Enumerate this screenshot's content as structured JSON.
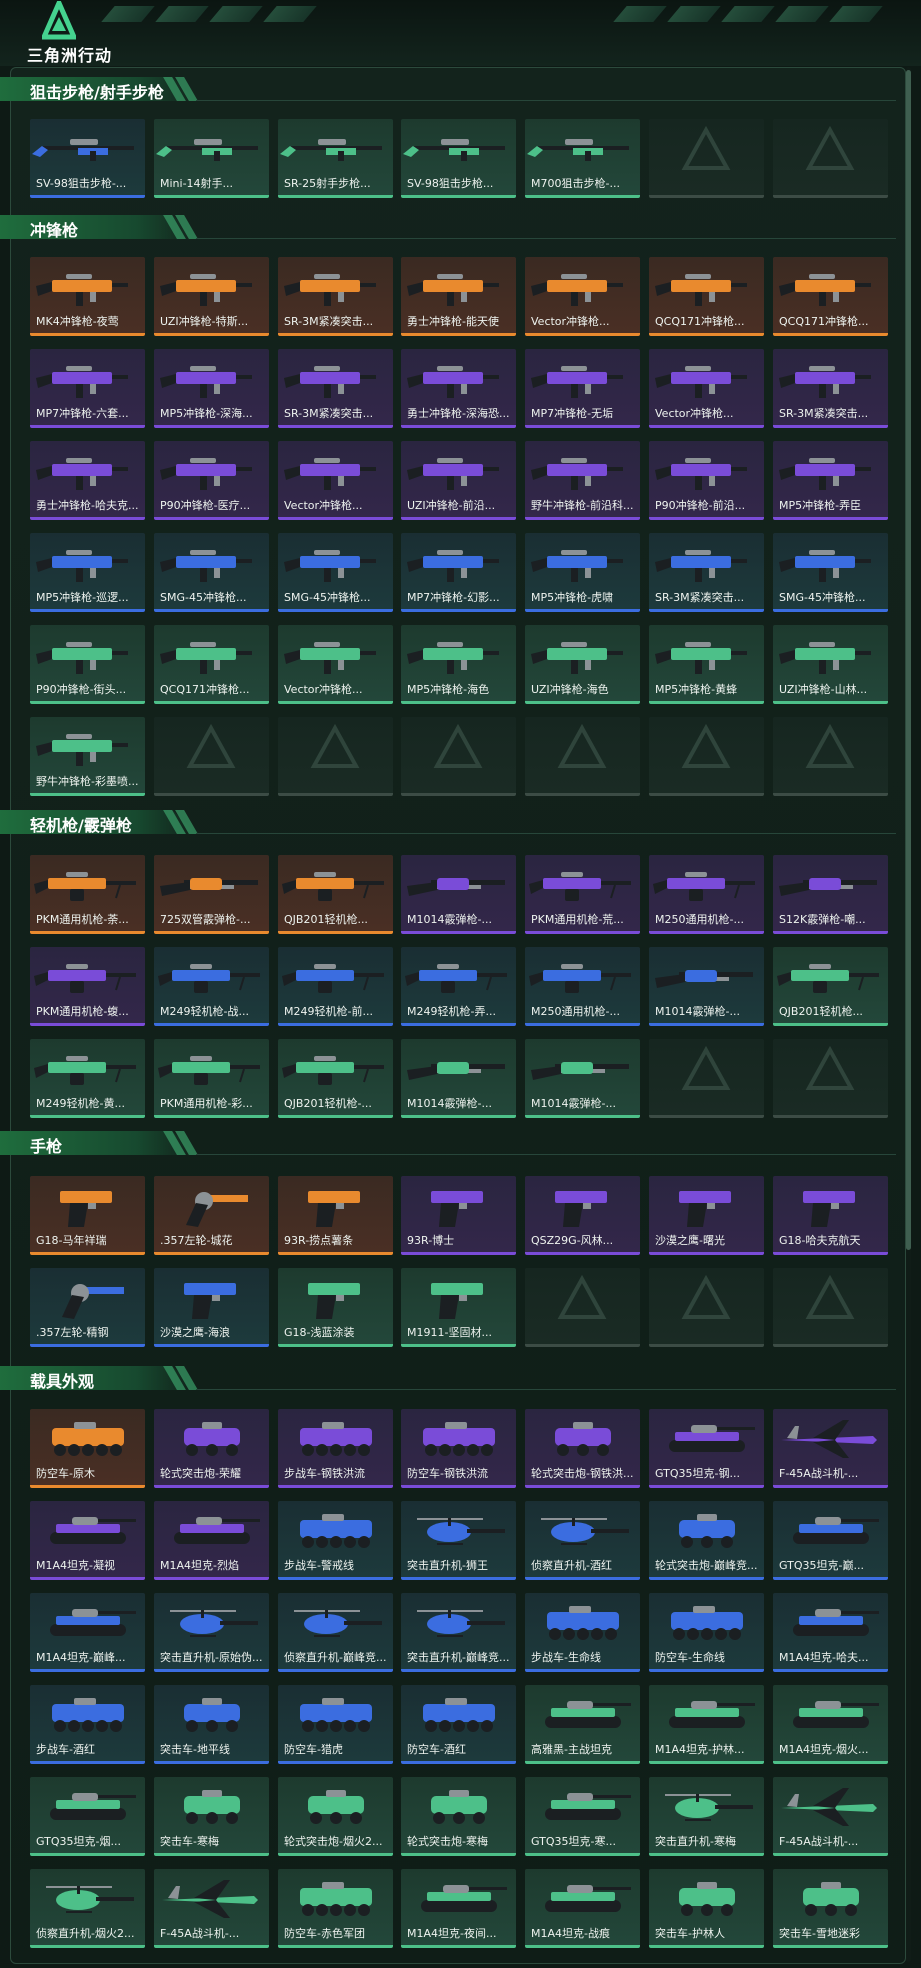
{
  "header": {
    "title": "三角洲行动"
  },
  "colors": {
    "green": "#4dc089",
    "blue": "#3b6de0",
    "purple": "#7a4cd8",
    "orange": "#e98a2e"
  },
  "sections": [
    {
      "title": "狙击步枪/射手步枪",
      "items": [
        {
          "label": "SV-98狙击步枪-...",
          "rarity": "blue",
          "icon": "rifle-icon"
        },
        {
          "label": "Mini-14射手...",
          "rarity": "green",
          "icon": "rifle-icon"
        },
        {
          "label": "SR-25射手步枪...",
          "rarity": "green",
          "icon": "rifle-icon"
        },
        {
          "label": "SV-98狙击步枪...",
          "rarity": "green",
          "icon": "rifle-icon"
        },
        {
          "label": "M700狙击步枪-...",
          "rarity": "green",
          "icon": "rifle-icon"
        },
        {
          "label": "",
          "rarity": "empty",
          "icon": "empty-slot-icon"
        },
        {
          "label": "",
          "rarity": "empty",
          "icon": "empty-slot-icon"
        }
      ]
    },
    {
      "title": "冲锋枪",
      "items": [
        {
          "label": "MK4冲锋枪-夜莺",
          "rarity": "orange",
          "icon": "smg-icon"
        },
        {
          "label": "UZI冲锋枪-特斯...",
          "rarity": "orange",
          "icon": "smg-icon"
        },
        {
          "label": "SR-3M紧凑突击...",
          "rarity": "orange",
          "icon": "smg-icon"
        },
        {
          "label": "勇士冲锋枪-能天使",
          "rarity": "orange",
          "icon": "smg-icon"
        },
        {
          "label": "Vector冲锋枪...",
          "rarity": "orange",
          "icon": "smg-icon"
        },
        {
          "label": "QCQ171冲锋枪...",
          "rarity": "orange",
          "icon": "smg-icon"
        },
        {
          "label": "QCQ171冲锋枪...",
          "rarity": "orange",
          "icon": "smg-icon"
        },
        {
          "label": "MP7冲锋枪-六套...",
          "rarity": "purple",
          "icon": "smg-icon"
        },
        {
          "label": "MP5冲锋枪-深海...",
          "rarity": "purple",
          "icon": "smg-icon"
        },
        {
          "label": "SR-3M紧凑突击...",
          "rarity": "purple",
          "icon": "smg-icon"
        },
        {
          "label": "勇士冲锋枪-深海恐...",
          "rarity": "purple",
          "icon": "smg-icon"
        },
        {
          "label": "MP7冲锋枪-无垢",
          "rarity": "purple",
          "icon": "smg-icon"
        },
        {
          "label": "Vector冲锋枪...",
          "rarity": "purple",
          "icon": "smg-icon"
        },
        {
          "label": "SR-3M紧凑突击...",
          "rarity": "purple",
          "icon": "smg-icon"
        },
        {
          "label": "勇士冲锋枪-哈夫克...",
          "rarity": "purple",
          "icon": "smg-icon"
        },
        {
          "label": "P90冲锋枪-医疗...",
          "rarity": "purple",
          "icon": "smg-icon"
        },
        {
          "label": "Vector冲锋枪...",
          "rarity": "purple",
          "icon": "smg-icon"
        },
        {
          "label": "UZI冲锋枪-前沿...",
          "rarity": "purple",
          "icon": "smg-icon"
        },
        {
          "label": "野牛冲锋枪-前沿科...",
          "rarity": "purple",
          "icon": "smg-icon"
        },
        {
          "label": "P90冲锋枪-前沿...",
          "rarity": "purple",
          "icon": "smg-icon"
        },
        {
          "label": "MP5冲锋枪-弄臣",
          "rarity": "purple",
          "icon": "smg-icon"
        },
        {
          "label": "MP5冲锋枪-巡逻...",
          "rarity": "blue",
          "icon": "smg-icon"
        },
        {
          "label": "SMG-45冲锋枪...",
          "rarity": "blue",
          "icon": "smg-icon"
        },
        {
          "label": "SMG-45冲锋枪...",
          "rarity": "blue",
          "icon": "smg-icon"
        },
        {
          "label": "MP7冲锋枪-幻影...",
          "rarity": "blue",
          "icon": "smg-icon"
        },
        {
          "label": "MP5冲锋枪-虎啸",
          "rarity": "blue",
          "icon": "smg-icon"
        },
        {
          "label": "SR-3M紧凑突击...",
          "rarity": "blue",
          "icon": "smg-icon"
        },
        {
          "label": "SMG-45冲锋枪...",
          "rarity": "blue",
          "icon": "smg-icon"
        },
        {
          "label": "P90冲锋枪-街头...",
          "rarity": "green",
          "icon": "smg-icon"
        },
        {
          "label": "QCQ171冲锋枪...",
          "rarity": "green",
          "icon": "smg-icon"
        },
        {
          "label": "Vector冲锋枪...",
          "rarity": "green",
          "icon": "smg-icon"
        },
        {
          "label": "MP5冲锋枪-海色",
          "rarity": "green",
          "icon": "smg-icon"
        },
        {
          "label": "UZI冲锋枪-海色",
          "rarity": "green",
          "icon": "smg-icon"
        },
        {
          "label": "MP5冲锋枪-黄蜂",
          "rarity": "green",
          "icon": "smg-icon"
        },
        {
          "label": "UZI冲锋枪-山林...",
          "rarity": "green",
          "icon": "smg-icon"
        },
        {
          "label": "野牛冲锋枪-彩墨喷...",
          "rarity": "green",
          "icon": "smg-icon"
        },
        {
          "label": "",
          "rarity": "empty",
          "icon": "empty-slot-icon"
        },
        {
          "label": "",
          "rarity": "empty",
          "icon": "empty-slot-icon"
        },
        {
          "label": "",
          "rarity": "empty",
          "icon": "empty-slot-icon"
        },
        {
          "label": "",
          "rarity": "empty",
          "icon": "empty-slot-icon"
        },
        {
          "label": "",
          "rarity": "empty",
          "icon": "empty-slot-icon"
        },
        {
          "label": "",
          "rarity": "empty",
          "icon": "empty-slot-icon"
        }
      ]
    },
    {
      "title": "轻机枪/霰弹枪",
      "items": [
        {
          "label": "PKM通用机枪-荼...",
          "rarity": "orange",
          "icon": "machine-gun-icon"
        },
        {
          "label": "725双管霰弹枪-...",
          "rarity": "orange",
          "icon": "shotgun-icon"
        },
        {
          "label": "QJB201轻机枪...",
          "rarity": "orange",
          "icon": "machine-gun-icon"
        },
        {
          "label": "M1014霰弹枪-...",
          "rarity": "purple",
          "icon": "shotgun-icon"
        },
        {
          "label": "PKM通用机枪-荒...",
          "rarity": "purple",
          "icon": "machine-gun-icon"
        },
        {
          "label": "M250通用机枪-...",
          "rarity": "purple",
          "icon": "machine-gun-icon"
        },
        {
          "label": "S12K霰弹枪-嘲...",
          "rarity": "purple",
          "icon": "shotgun-icon"
        },
        {
          "label": "PKM通用机枪-蝮...",
          "rarity": "purple",
          "icon": "machine-gun-icon"
        },
        {
          "label": "M249轻机枪-战...",
          "rarity": "blue",
          "icon": "machine-gun-icon"
        },
        {
          "label": "M249轻机枪-前...",
          "rarity": "blue",
          "icon": "machine-gun-icon"
        },
        {
          "label": "M249轻机枪-弄...",
          "rarity": "blue",
          "icon": "machine-gun-icon"
        },
        {
          "label": "M250通用机枪-...",
          "rarity": "blue",
          "icon": "machine-gun-icon"
        },
        {
          "label": "M1014霰弹枪-...",
          "rarity": "blue",
          "icon": "shotgun-icon"
        },
        {
          "label": "QJB201轻机枪...",
          "rarity": "green",
          "icon": "machine-gun-icon"
        },
        {
          "label": "M249轻机枪-黄...",
          "rarity": "green",
          "icon": "machine-gun-icon"
        },
        {
          "label": "PKM通用机枪-彩...",
          "rarity": "green",
          "icon": "machine-gun-icon"
        },
        {
          "label": "QJB201轻机枪-...",
          "rarity": "green",
          "icon": "machine-gun-icon"
        },
        {
          "label": "M1014霰弹枪-...",
          "rarity": "green",
          "icon": "shotgun-icon"
        },
        {
          "label": "M1014霰弹枪-...",
          "rarity": "green",
          "icon": "shotgun-icon"
        },
        {
          "label": "",
          "rarity": "empty",
          "icon": "empty-slot-icon"
        },
        {
          "label": "",
          "rarity": "empty",
          "icon": "empty-slot-icon"
        }
      ]
    },
    {
      "title": "手枪",
      "items": [
        {
          "label": "G18-马年祥瑞",
          "rarity": "orange",
          "icon": "pistol-icon"
        },
        {
          "label": ".357左轮-城花",
          "rarity": "orange",
          "icon": "revolver-icon"
        },
        {
          "label": "93R-捞点薯条",
          "rarity": "orange",
          "icon": "pistol-icon"
        },
        {
          "label": "93R-博士",
          "rarity": "purple",
          "icon": "pistol-icon"
        },
        {
          "label": "QSZ29G-风林...",
          "rarity": "purple",
          "icon": "pistol-icon"
        },
        {
          "label": "沙漠之鹰-曙光",
          "rarity": "purple",
          "icon": "pistol-icon"
        },
        {
          "label": "G18-哈夫克航天",
          "rarity": "purple",
          "icon": "pistol-icon"
        },
        {
          "label": ".357左轮-精钢",
          "rarity": "blue",
          "icon": "revolver-icon"
        },
        {
          "label": "沙漠之鹰-海浪",
          "rarity": "blue",
          "icon": "pistol-icon"
        },
        {
          "label": "G18-浅蓝涂装",
          "rarity": "green",
          "icon": "pistol-icon"
        },
        {
          "label": "M1911-坚固材...",
          "rarity": "green",
          "icon": "pistol-icon"
        },
        {
          "label": "",
          "rarity": "empty",
          "icon": "empty-slot-icon"
        },
        {
          "label": "",
          "rarity": "empty",
          "icon": "empty-slot-icon"
        },
        {
          "label": "",
          "rarity": "empty",
          "icon": "empty-slot-icon"
        }
      ]
    },
    {
      "title": "载具外观",
      "items": [
        {
          "label": "防空车-原木",
          "rarity": "orange",
          "icon": "apc-icon"
        },
        {
          "label": "轮式突击炮-荣耀",
          "rarity": "purple",
          "icon": "armored-car-icon"
        },
        {
          "label": "步战车-钢铁洪流",
          "rarity": "purple",
          "icon": "apc-icon"
        },
        {
          "label": "防空车-钢铁洪流",
          "rarity": "purple",
          "icon": "apc-icon"
        },
        {
          "label": "轮式突击炮-钢铁洪...",
          "rarity": "purple",
          "icon": "armored-car-icon"
        },
        {
          "label": "GTQ35坦克-钢...",
          "rarity": "purple",
          "icon": "tank-icon"
        },
        {
          "label": "F-45A战斗机-...",
          "rarity": "purple",
          "icon": "jet-icon"
        },
        {
          "label": "M1A4坦克-凝视",
          "rarity": "purple",
          "icon": "tank-icon"
        },
        {
          "label": "M1A4坦克-烈焰",
          "rarity": "purple",
          "icon": "tank-icon"
        },
        {
          "label": "步战车-警戒线",
          "rarity": "blue",
          "icon": "apc-icon"
        },
        {
          "label": "突击直升机-狮王",
          "rarity": "blue",
          "icon": "helicopter-icon"
        },
        {
          "label": "侦察直升机-酒红",
          "rarity": "blue",
          "icon": "helicopter-icon"
        },
        {
          "label": "轮式突击炮-巅峰竞...",
          "rarity": "blue",
          "icon": "armored-car-icon"
        },
        {
          "label": "GTQ35坦克-巅...",
          "rarity": "blue",
          "icon": "tank-icon"
        },
        {
          "label": "M1A4坦克-巅峰...",
          "rarity": "blue",
          "icon": "tank-icon"
        },
        {
          "label": "突击直升机-原始伪...",
          "rarity": "blue",
          "icon": "helicopter-icon"
        },
        {
          "label": "侦察直升机-巅峰竞...",
          "rarity": "blue",
          "icon": "helicopter-icon"
        },
        {
          "label": "突击直升机-巅峰竞...",
          "rarity": "blue",
          "icon": "helicopter-icon"
        },
        {
          "label": "步战车-生命线",
          "rarity": "blue",
          "icon": "apc-icon"
        },
        {
          "label": "防空车-生命线",
          "rarity": "blue",
          "icon": "apc-icon"
        },
        {
          "label": "M1A4坦克-哈夫...",
          "rarity": "blue",
          "icon": "tank-icon"
        },
        {
          "label": "步战车-酒红",
          "rarity": "blue",
          "icon": "apc-icon"
        },
        {
          "label": "突击车-地平线",
          "rarity": "blue",
          "icon": "armored-car-icon"
        },
        {
          "label": "防空车-猎虎",
          "rarity": "blue",
          "icon": "apc-icon"
        },
        {
          "label": "防空车-酒红",
          "rarity": "blue",
          "icon": "apc-icon"
        },
        {
          "label": "高雅黑-主战坦克",
          "rarity": "green",
          "icon": "tank-icon"
        },
        {
          "label": "M1A4坦克-护林...",
          "rarity": "green",
          "icon": "tank-icon"
        },
        {
          "label": "M1A4坦克-烟火...",
          "rarity": "green",
          "icon": "tank-icon"
        },
        {
          "label": "GTQ35坦克-烟...",
          "rarity": "green",
          "icon": "tank-icon"
        },
        {
          "label": "突击车-寒梅",
          "rarity": "green",
          "icon": "armored-car-icon"
        },
        {
          "label": "轮式突击炮-烟火2...",
          "rarity": "green",
          "icon": "armored-car-icon"
        },
        {
          "label": "轮式突击炮-寒梅",
          "rarity": "green",
          "icon": "armored-car-icon"
        },
        {
          "label": "GTQ35坦克-寒...",
          "rarity": "green",
          "icon": "tank-icon"
        },
        {
          "label": "突击直升机-寒梅",
          "rarity": "green",
          "icon": "helicopter-icon"
        },
        {
          "label": "F-45A战斗机-...",
          "rarity": "green",
          "icon": "jet-icon"
        },
        {
          "label": "侦察直升机-烟火2...",
          "rarity": "green",
          "icon": "helicopter-icon"
        },
        {
          "label": "F-45A战斗机-...",
          "rarity": "green",
          "icon": "jet-icon"
        },
        {
          "label": "防空车-赤色军团",
          "rarity": "green",
          "icon": "apc-icon"
        },
        {
          "label": "M1A4坦克-夜间...",
          "rarity": "green",
          "icon": "tank-icon"
        },
        {
          "label": "M1A4坦克-战痕",
          "rarity": "green",
          "icon": "tank-icon"
        },
        {
          "label": "突击车-护林人",
          "rarity": "green",
          "icon": "armored-car-icon"
        },
        {
          "label": "突击车-雪地迷彩",
          "rarity": "green",
          "icon": "armored-car-icon"
        }
      ]
    }
  ]
}
